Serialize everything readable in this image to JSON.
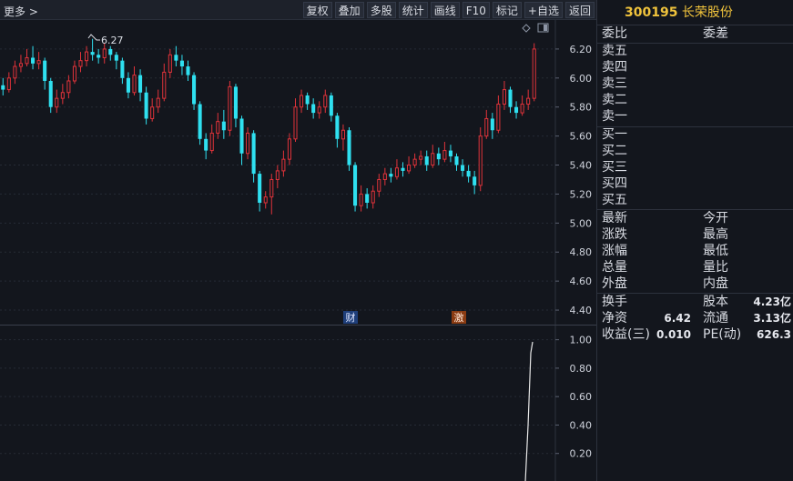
{
  "toolbar": {
    "more_label": "更多",
    "buttons": [
      "复权",
      "叠加",
      "多股",
      "统计",
      "画线",
      "F10",
      "标记",
      "+自选",
      "返回"
    ]
  },
  "stock": {
    "code": "300195",
    "name": "长荣股份"
  },
  "panel": {
    "ratio_label": "委比",
    "diff_label": "委差",
    "sell_labels": [
      "卖五",
      "卖四",
      "卖三",
      "卖二",
      "卖一"
    ],
    "buy_labels": [
      "买一",
      "买二",
      "买三",
      "买四",
      "买五"
    ],
    "quote_left": [
      "最新",
      "涨跌",
      "涨幅",
      "总量",
      "外盘"
    ],
    "quote_right": [
      "今开",
      "最高",
      "最低",
      "量比",
      "内盘"
    ],
    "stats": [
      {
        "l": "换手",
        "lv": "",
        "r": "股本",
        "rv": "4.23亿"
      },
      {
        "l": "净资",
        "lv": "6.42",
        "r": "流通",
        "rv": "3.13亿"
      },
      {
        "l": "收益(三)",
        "lv": "0.010",
        "r": "PE(动)",
        "rv": "626.3"
      }
    ]
  },
  "chart_data": [
    {
      "type": "candlestick",
      "y_ticks": [
        "6.20",
        "6.00",
        "5.80",
        "5.60",
        "5.40",
        "5.20",
        "5.00",
        "4.80",
        "4.60",
        "4.40"
      ],
      "ylim": [
        4.3,
        6.4
      ],
      "annotation": "6.27",
      "markers": [
        "财",
        "激"
      ],
      "colors": {
        "up": "#e0333a",
        "down": "#2fe0f0"
      },
      "candles": [
        [
          5.95,
          5.92,
          6.0,
          5.88
        ],
        [
          5.92,
          6.0,
          6.04,
          5.9
        ],
        [
          6.0,
          6.08,
          6.12,
          5.96
        ],
        [
          6.08,
          6.1,
          6.16,
          6.04
        ],
        [
          6.1,
          6.14,
          6.2,
          6.08
        ],
        [
          6.14,
          6.1,
          6.22,
          6.06
        ],
        [
          6.1,
          6.12,
          6.18,
          6.06
        ],
        [
          6.12,
          5.98,
          6.14,
          5.92
        ],
        [
          5.98,
          5.8,
          6.0,
          5.76
        ],
        [
          5.8,
          5.86,
          5.92,
          5.76
        ],
        [
          5.86,
          5.9,
          5.96,
          5.82
        ],
        [
          5.9,
          5.98,
          6.02,
          5.86
        ],
        [
          5.98,
          6.08,
          6.12,
          5.96
        ],
        [
          6.08,
          6.12,
          6.18,
          6.04
        ],
        [
          6.12,
          6.18,
          6.22,
          6.08
        ],
        [
          6.18,
          6.16,
          6.27,
          6.12
        ],
        [
          6.16,
          6.14,
          6.2,
          6.1
        ],
        [
          6.14,
          6.2,
          6.24,
          6.1
        ],
        [
          6.2,
          6.16,
          6.22,
          6.12
        ],
        [
          6.16,
          6.12,
          6.18,
          6.06
        ],
        [
          6.12,
          6.0,
          6.14,
          5.96
        ],
        [
          6.0,
          5.9,
          6.04,
          5.86
        ],
        [
          5.9,
          6.02,
          6.08,
          5.88
        ],
        [
          6.02,
          5.9,
          6.06,
          5.84
        ],
        [
          5.9,
          5.72,
          5.94,
          5.68
        ],
        [
          5.72,
          5.8,
          5.86,
          5.7
        ],
        [
          5.8,
          5.86,
          5.92,
          5.76
        ],
        [
          5.86,
          6.04,
          6.1,
          5.84
        ],
        [
          6.04,
          6.16,
          6.2,
          6.0
        ],
        [
          6.16,
          6.12,
          6.22,
          6.08
        ],
        [
          6.12,
          6.08,
          6.16,
          6.02
        ],
        [
          6.08,
          6.02,
          6.12,
          5.98
        ],
        [
          6.02,
          5.82,
          6.04,
          5.78
        ],
        [
          5.82,
          5.58,
          5.84,
          5.54
        ],
        [
          5.58,
          5.5,
          5.62,
          5.44
        ],
        [
          5.5,
          5.62,
          5.68,
          5.48
        ],
        [
          5.62,
          5.7,
          5.76,
          5.58
        ],
        [
          5.7,
          5.64,
          5.78,
          5.58
        ],
        [
          5.64,
          5.94,
          5.98,
          5.6
        ],
        [
          5.94,
          5.72,
          5.96,
          5.66
        ],
        [
          5.72,
          5.48,
          5.74,
          5.4
        ],
        [
          5.48,
          5.62,
          5.66,
          5.44
        ],
        [
          5.62,
          5.34,
          5.64,
          5.28
        ],
        [
          5.34,
          5.14,
          5.36,
          5.08
        ],
        [
          5.14,
          5.18,
          5.22,
          5.1
        ],
        [
          5.18,
          5.3,
          5.34,
          5.06
        ],
        [
          5.3,
          5.36,
          5.4,
          5.24
        ],
        [
          5.36,
          5.44,
          5.5,
          5.32
        ],
        [
          5.44,
          5.58,
          5.62,
          5.4
        ],
        [
          5.58,
          5.8,
          5.86,
          5.56
        ],
        [
          5.8,
          5.88,
          5.92,
          5.76
        ],
        [
          5.88,
          5.82,
          5.9,
          5.78
        ],
        [
          5.82,
          5.76,
          5.86,
          5.72
        ],
        [
          5.76,
          5.8,
          5.84,
          5.72
        ],
        [
          5.8,
          5.88,
          5.92,
          5.76
        ],
        [
          5.88,
          5.74,
          5.9,
          5.7
        ],
        [
          5.74,
          5.58,
          5.76,
          5.52
        ],
        [
          5.58,
          5.64,
          5.68,
          5.5
        ],
        [
          5.64,
          5.4,
          5.66,
          5.36
        ],
        [
          5.4,
          5.12,
          5.42,
          5.08
        ],
        [
          5.12,
          5.2,
          5.26,
          5.08
        ],
        [
          5.2,
          5.14,
          5.24,
          5.1
        ],
        [
          5.14,
          5.22,
          5.26,
          5.1
        ],
        [
          5.22,
          5.3,
          5.34,
          5.18
        ],
        [
          5.3,
          5.34,
          5.38,
          5.26
        ],
        [
          5.34,
          5.32,
          5.38,
          5.28
        ],
        [
          5.32,
          5.38,
          5.44,
          5.3
        ],
        [
          5.38,
          5.36,
          5.42,
          5.32
        ],
        [
          5.36,
          5.4,
          5.46,
          5.34
        ],
        [
          5.4,
          5.44,
          5.48,
          5.38
        ],
        [
          5.44,
          5.46,
          5.5,
          5.4
        ],
        [
          5.46,
          5.4,
          5.5,
          5.36
        ],
        [
          5.4,
          5.48,
          5.54,
          5.38
        ],
        [
          5.48,
          5.44,
          5.52,
          5.4
        ],
        [
          5.44,
          5.5,
          5.56,
          5.42
        ],
        [
          5.5,
          5.46,
          5.54,
          5.42
        ],
        [
          5.46,
          5.4,
          5.48,
          5.36
        ],
        [
          5.4,
          5.36,
          5.44,
          5.32
        ],
        [
          5.36,
          5.32,
          5.4,
          5.28
        ],
        [
          5.32,
          5.26,
          5.36,
          5.2
        ],
        [
          5.26,
          5.6,
          5.66,
          5.22
        ],
        [
          5.6,
          5.72,
          5.78,
          5.58
        ],
        [
          5.72,
          5.64,
          5.76,
          5.58
        ],
        [
          5.64,
          5.82,
          5.88,
          5.62
        ],
        [
          5.82,
          5.92,
          5.98,
          5.78
        ],
        [
          5.92,
          5.8,
          5.94,
          5.76
        ],
        [
          5.8,
          5.76,
          5.84,
          5.72
        ],
        [
          5.76,
          5.82,
          5.88,
          5.74
        ],
        [
          5.82,
          5.86,
          5.92,
          5.78
        ],
        [
          5.86,
          6.2,
          6.24,
          5.84
        ]
      ]
    },
    {
      "type": "line",
      "y_ticks": [
        "1.00",
        "0.80",
        "0.60",
        "0.40",
        "0.20"
      ],
      "ylim": [
        0,
        1.1
      ]
    }
  ]
}
